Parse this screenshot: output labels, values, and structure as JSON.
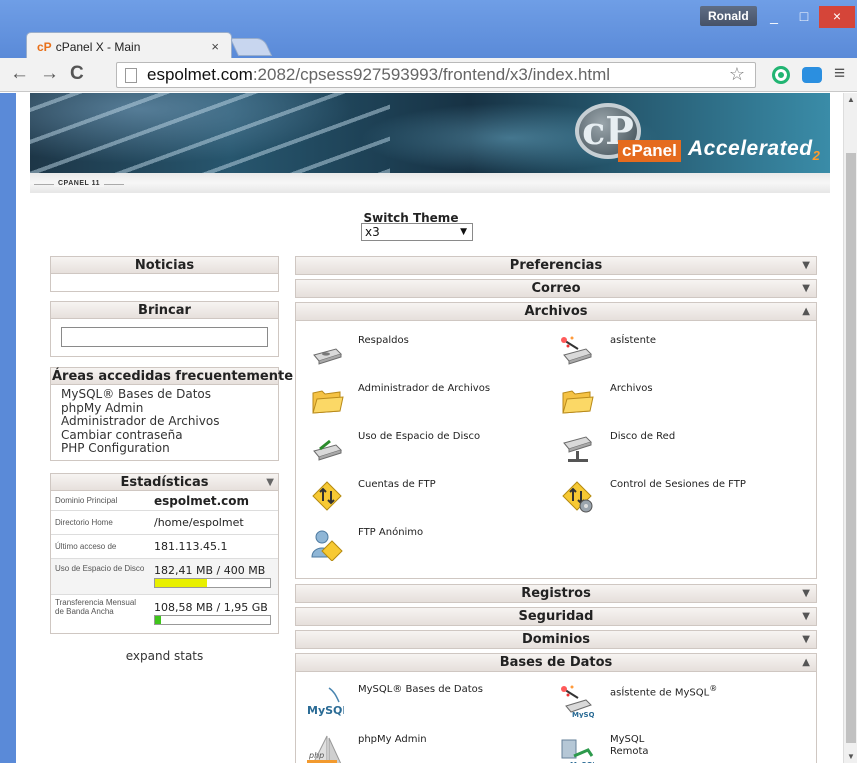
{
  "browser": {
    "tab_title": "cPanel X - Main",
    "tab_favicon": "cP",
    "tab_close": "×",
    "user": "Ronald",
    "url_host": "espolmet.com",
    "url_rest": ":2082/cpsess927593993/frontend/x3/index.html",
    "nav_back": "←",
    "nav_forward": "→",
    "nav_reload": "C",
    "star": "☆",
    "menu": "≡",
    "win_min": "_",
    "win_max": "□",
    "win_close": "×"
  },
  "banner": {
    "logo_letters": "cP",
    "brand": "cPanel",
    "accelerated": "Accelerated",
    "accelerated_sub": "2",
    "version_label": "CPANEL 11"
  },
  "theme": {
    "label": "Switch Theme",
    "selected": "x3",
    "arrow": "▼"
  },
  "sidebar": {
    "noticias": "Noticias",
    "brincar": "Brincar",
    "frequent_title": "Áreas accedidas frecuentemente",
    "frequent_items": [
      "MySQL® Bases de Datos",
      "phpMy Admin",
      "Administrador de Archivos",
      "Cambiar contraseña",
      "PHP Configuration"
    ],
    "stats_title": "Estadísticas",
    "stats_arrow": "▼",
    "stats": [
      {
        "label": "Dominio Principal",
        "value": "espolmet.com"
      },
      {
        "label": "Directorio Home",
        "value": "/home/espolmet"
      },
      {
        "label": "Último acceso de",
        "value": "181.113.45.1"
      },
      {
        "label": "Uso de Espacio de Disco",
        "value": "182,41 MB / 400 MB",
        "fraction": 0.456
      },
      {
        "label": "Transferencia Mensual de Banda Ancha",
        "value": "108,58 MB / 1,95 GB",
        "fraction": 0.054
      }
    ],
    "expand_stats": "expand stats"
  },
  "groups": {
    "preferencias": "Preferencias",
    "correo": "Correo",
    "archivos": "Archivos",
    "registros": "Registros",
    "seguridad": "Seguridad",
    "dominios": "Dominios",
    "bases_de_datos": "Bases de Datos",
    "arrow_collapsed": "▼",
    "arrow_expanded": "▲"
  },
  "archivos_items": [
    {
      "label": "Respaldos",
      "icon": "backup-icon"
    },
    {
      "label": "asÍstente",
      "icon": "backup-wizard-icon"
    },
    {
      "label": "Administrador de Archivos",
      "icon": "folder-icon"
    },
    {
      "label": "Archivos",
      "icon": "folder-icon"
    },
    {
      "label": "Uso de Espacio de Disco",
      "icon": "disk-usage-icon"
    },
    {
      "label": "Disco de Red",
      "icon": "network-disk-icon"
    },
    {
      "label": "Cuentas de FTP",
      "icon": "ftp-accounts-icon"
    },
    {
      "label": "Control de Sesiones de FTP",
      "icon": "ftp-sessions-icon"
    },
    {
      "label": "FTP Anónimo",
      "icon": "anonymous-ftp-icon"
    }
  ],
  "db_items": [
    {
      "label": "MySQL® Bases de Datos",
      "icon": "mysql-icon"
    },
    {
      "label": "asÍstente de MySQL",
      "sup": "®",
      "icon": "mysql-wizard-icon"
    },
    {
      "label": "phpMy Admin",
      "icon": "phpmyadmin-icon"
    },
    {
      "label": "MySQL",
      "label2": "Remota",
      "icon": "remote-mysql-icon"
    }
  ],
  "icon_text": {
    "mysql": "MySQL",
    "php": "php"
  },
  "colors": {
    "disk_bar": "#e8f000",
    "bw_bar": "#3fc51b",
    "cpanel_orange": "#e56b1e"
  }
}
